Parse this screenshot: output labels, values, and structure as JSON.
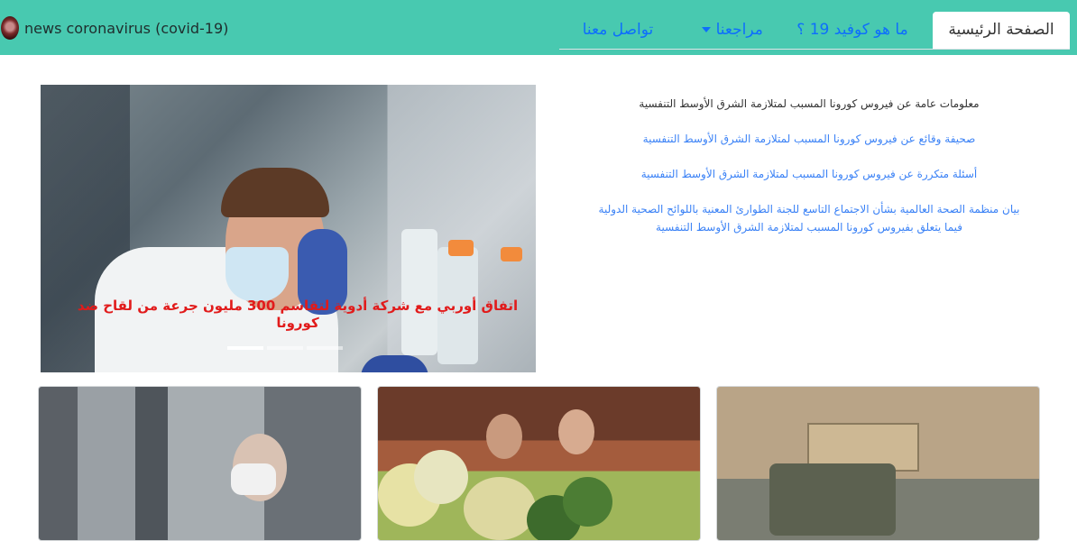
{
  "navbar": {
    "brand_text": "news coronavirus (covid-19)",
    "tabs": [
      {
        "label": "الصفحة الرئيسية",
        "active": true
      },
      {
        "label": "ما هو كوفيد 19 ؟",
        "active": false
      },
      {
        "label": "مراجعنا",
        "active": false,
        "dropdown": true
      },
      {
        "label": "تواصل معنا",
        "active": false
      }
    ]
  },
  "carousel": {
    "caption": "اتفاق أوربي مع شركة أدوية لتقاسم 300 مليون جرعة من لقاح ضد كورونا",
    "slide_count": 3,
    "active_slide": 1
  },
  "articles": [
    {
      "text": "معلومات عامة عن فيروس كورونا المسبب لمتلازمة الشرق الأوسط التنفسية",
      "link": false
    },
    {
      "text": "صحيفة وقائع عن فيروس كورونا المسبب لمتلازمة الشرق الأوسط التنفسية",
      "link": true
    },
    {
      "text": "أسئلة متكررة عن فيروس كورونا المسبب لمتلازمة الشرق الأوسط التنفسية",
      "link": true
    },
    {
      "text": "بيان منظمة الصحة العالمية بشأن الاجتماع التاسع للجنة الطوارئ المعنية باللوائح الصحية الدولية فيما يتعلق بفيروس كورونا المسبب لمتلازمة الشرق الأوسط التنفسية",
      "link": true
    }
  ],
  "colors": {
    "navbar": "#48c9b0",
    "link": "#3b82f6",
    "caption": "#e11b1b"
  }
}
